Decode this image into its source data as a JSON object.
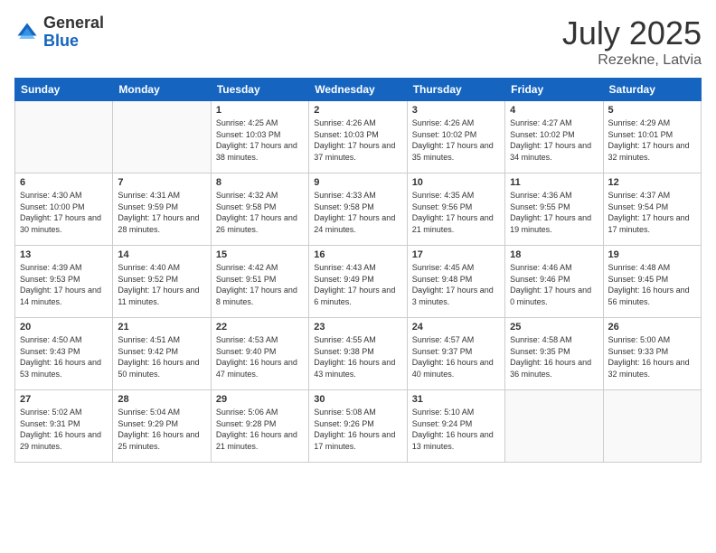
{
  "header": {
    "logo_general": "General",
    "logo_blue": "Blue",
    "title": "July 2025",
    "location": "Rezekne, Latvia"
  },
  "days_of_week": [
    "Sunday",
    "Monday",
    "Tuesday",
    "Wednesday",
    "Thursday",
    "Friday",
    "Saturday"
  ],
  "weeks": [
    [
      {
        "day": "",
        "info": ""
      },
      {
        "day": "",
        "info": ""
      },
      {
        "day": "1",
        "info": "Sunrise: 4:25 AM\nSunset: 10:03 PM\nDaylight: 17 hours and 38 minutes."
      },
      {
        "day": "2",
        "info": "Sunrise: 4:26 AM\nSunset: 10:03 PM\nDaylight: 17 hours and 37 minutes."
      },
      {
        "day": "3",
        "info": "Sunrise: 4:26 AM\nSunset: 10:02 PM\nDaylight: 17 hours and 35 minutes."
      },
      {
        "day": "4",
        "info": "Sunrise: 4:27 AM\nSunset: 10:02 PM\nDaylight: 17 hours and 34 minutes."
      },
      {
        "day": "5",
        "info": "Sunrise: 4:29 AM\nSunset: 10:01 PM\nDaylight: 17 hours and 32 minutes."
      }
    ],
    [
      {
        "day": "6",
        "info": "Sunrise: 4:30 AM\nSunset: 10:00 PM\nDaylight: 17 hours and 30 minutes."
      },
      {
        "day": "7",
        "info": "Sunrise: 4:31 AM\nSunset: 9:59 PM\nDaylight: 17 hours and 28 minutes."
      },
      {
        "day": "8",
        "info": "Sunrise: 4:32 AM\nSunset: 9:58 PM\nDaylight: 17 hours and 26 minutes."
      },
      {
        "day": "9",
        "info": "Sunrise: 4:33 AM\nSunset: 9:58 PM\nDaylight: 17 hours and 24 minutes."
      },
      {
        "day": "10",
        "info": "Sunrise: 4:35 AM\nSunset: 9:56 PM\nDaylight: 17 hours and 21 minutes."
      },
      {
        "day": "11",
        "info": "Sunrise: 4:36 AM\nSunset: 9:55 PM\nDaylight: 17 hours and 19 minutes."
      },
      {
        "day": "12",
        "info": "Sunrise: 4:37 AM\nSunset: 9:54 PM\nDaylight: 17 hours and 17 minutes."
      }
    ],
    [
      {
        "day": "13",
        "info": "Sunrise: 4:39 AM\nSunset: 9:53 PM\nDaylight: 17 hours and 14 minutes."
      },
      {
        "day": "14",
        "info": "Sunrise: 4:40 AM\nSunset: 9:52 PM\nDaylight: 17 hours and 11 minutes."
      },
      {
        "day": "15",
        "info": "Sunrise: 4:42 AM\nSunset: 9:51 PM\nDaylight: 17 hours and 8 minutes."
      },
      {
        "day": "16",
        "info": "Sunrise: 4:43 AM\nSunset: 9:49 PM\nDaylight: 17 hours and 6 minutes."
      },
      {
        "day": "17",
        "info": "Sunrise: 4:45 AM\nSunset: 9:48 PM\nDaylight: 17 hours and 3 minutes."
      },
      {
        "day": "18",
        "info": "Sunrise: 4:46 AM\nSunset: 9:46 PM\nDaylight: 17 hours and 0 minutes."
      },
      {
        "day": "19",
        "info": "Sunrise: 4:48 AM\nSunset: 9:45 PM\nDaylight: 16 hours and 56 minutes."
      }
    ],
    [
      {
        "day": "20",
        "info": "Sunrise: 4:50 AM\nSunset: 9:43 PM\nDaylight: 16 hours and 53 minutes."
      },
      {
        "day": "21",
        "info": "Sunrise: 4:51 AM\nSunset: 9:42 PM\nDaylight: 16 hours and 50 minutes."
      },
      {
        "day": "22",
        "info": "Sunrise: 4:53 AM\nSunset: 9:40 PM\nDaylight: 16 hours and 47 minutes."
      },
      {
        "day": "23",
        "info": "Sunrise: 4:55 AM\nSunset: 9:38 PM\nDaylight: 16 hours and 43 minutes."
      },
      {
        "day": "24",
        "info": "Sunrise: 4:57 AM\nSunset: 9:37 PM\nDaylight: 16 hours and 40 minutes."
      },
      {
        "day": "25",
        "info": "Sunrise: 4:58 AM\nSunset: 9:35 PM\nDaylight: 16 hours and 36 minutes."
      },
      {
        "day": "26",
        "info": "Sunrise: 5:00 AM\nSunset: 9:33 PM\nDaylight: 16 hours and 32 minutes."
      }
    ],
    [
      {
        "day": "27",
        "info": "Sunrise: 5:02 AM\nSunset: 9:31 PM\nDaylight: 16 hours and 29 minutes."
      },
      {
        "day": "28",
        "info": "Sunrise: 5:04 AM\nSunset: 9:29 PM\nDaylight: 16 hours and 25 minutes."
      },
      {
        "day": "29",
        "info": "Sunrise: 5:06 AM\nSunset: 9:28 PM\nDaylight: 16 hours and 21 minutes."
      },
      {
        "day": "30",
        "info": "Sunrise: 5:08 AM\nSunset: 9:26 PM\nDaylight: 16 hours and 17 minutes."
      },
      {
        "day": "31",
        "info": "Sunrise: 5:10 AM\nSunset: 9:24 PM\nDaylight: 16 hours and 13 minutes."
      },
      {
        "day": "",
        "info": ""
      },
      {
        "day": "",
        "info": ""
      }
    ]
  ]
}
